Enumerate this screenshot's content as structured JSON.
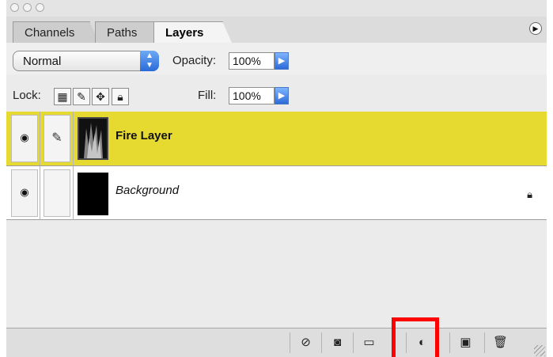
{
  "tabs": [
    "Channels",
    "Paths",
    "Layers"
  ],
  "blend_mode": "Normal",
  "opacity_label": "Opacity:",
  "opacity_value": "100%",
  "lock_label": "Lock:",
  "fill_label": "Fill:",
  "fill_value": "100%",
  "layers": [
    {
      "name": "Fire Layer",
      "selected": true
    },
    {
      "name": "Background",
      "locked": true
    }
  ],
  "icons": {
    "eye": "eye-icon",
    "brush": "brush-icon",
    "lock": "lock-icon",
    "panel_menu": "panel-menu-icon",
    "bottom": [
      "layer-style-icon",
      "layer-mask-icon",
      "new-group-icon",
      "adjustment-layer-icon",
      "new-layer-icon",
      "trash-icon"
    ]
  },
  "colors": {
    "selected_layer": "#e6d930",
    "highlight": "#ff0000"
  }
}
